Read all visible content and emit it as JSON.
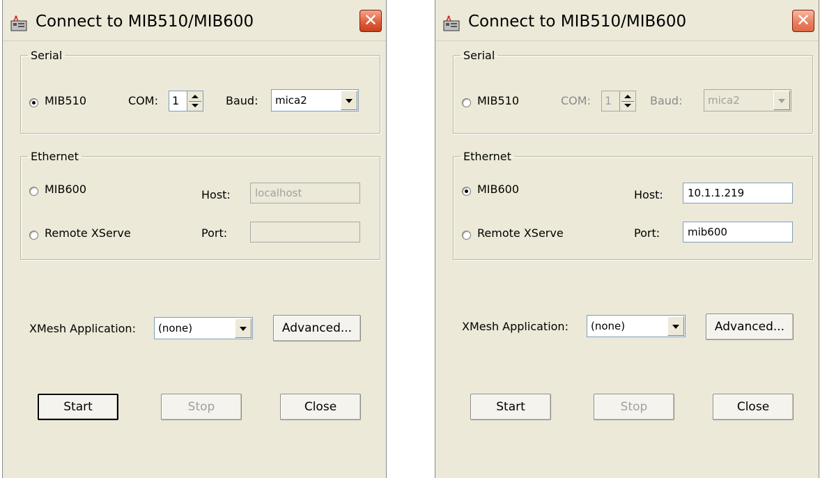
{
  "dialogs": [
    {
      "title": "Connect to MIB510/MIB600",
      "serial": {
        "legend": "Serial",
        "mib510_label": "MIB510",
        "com_label": "COM:",
        "com_value": "1",
        "baud_label": "Baud:",
        "baud_value": "mica2"
      },
      "ethernet": {
        "legend": "Ethernet",
        "mib600_label": "MIB600",
        "remote_label": "Remote XServe",
        "host_label": "Host:",
        "host_value": "localhost",
        "port_label": "Port:",
        "port_value": ""
      },
      "xmesh": {
        "label": "XMesh Application:",
        "value": "(none)",
        "advanced_label": "Advanced..."
      },
      "buttons": {
        "start": "Start",
        "stop": "Stop",
        "close": "Close"
      }
    },
    {
      "title": "Connect to MIB510/MIB600",
      "serial": {
        "legend": "Serial",
        "mib510_label": "MIB510",
        "com_label": "COM:",
        "com_value": "1",
        "baud_label": "Baud:",
        "baud_value": "mica2"
      },
      "ethernet": {
        "legend": "Ethernet",
        "mib600_label": "MIB600",
        "remote_label": "Remote XServe",
        "host_label": "Host:",
        "host_value": "10.1.1.219",
        "port_label": "Port:",
        "port_value": "mib600"
      },
      "xmesh": {
        "label": "XMesh Application:",
        "value": "(none)",
        "advanced_label": "Advanced..."
      },
      "buttons": {
        "start": "Start",
        "stop": "Stop",
        "close": "Close"
      }
    }
  ],
  "icons": {
    "app": "mote-app-icon",
    "close": "close-icon"
  }
}
